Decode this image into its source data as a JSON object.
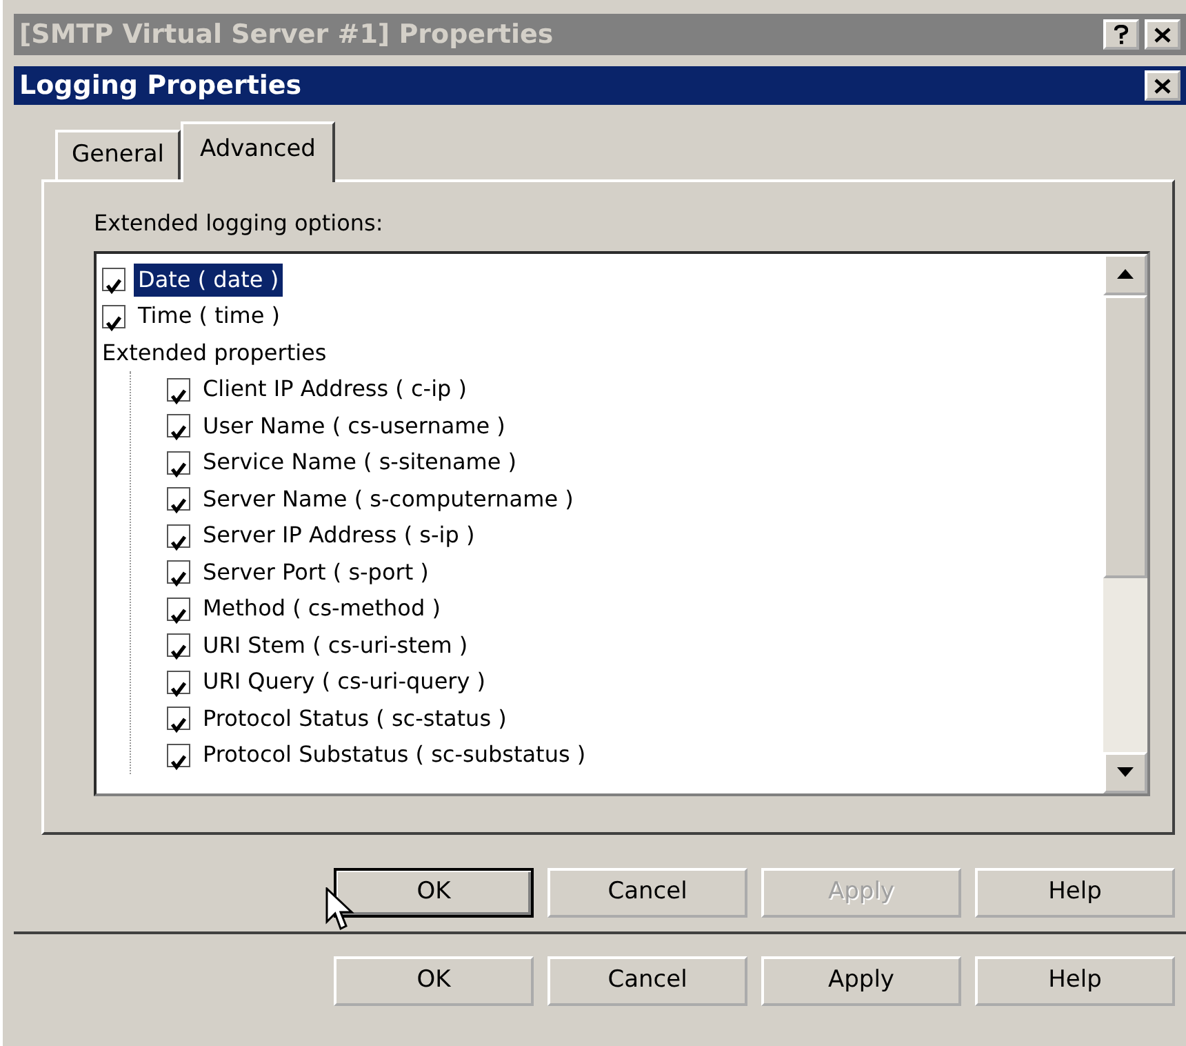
{
  "outer_window": {
    "title": "[SMTP Virtual Server #1] Properties",
    "buttons": [
      {
        "label": "OK",
        "disabled": false,
        "default": false
      },
      {
        "label": "Cancel",
        "disabled": false,
        "default": false
      },
      {
        "label": "Apply",
        "disabled": false,
        "default": false
      },
      {
        "label": "Help",
        "disabled": false,
        "default": false
      }
    ]
  },
  "dialog": {
    "title": "Logging Properties",
    "tabs": [
      {
        "label": "General",
        "selected": false
      },
      {
        "label": "Advanced",
        "selected": true
      }
    ],
    "group_label": "Extended logging options:",
    "options": [
      {
        "label": "Date ( date )",
        "checked": true,
        "selected": true
      },
      {
        "label": "Time ( time )",
        "checked": true,
        "selected": false
      },
      {
        "label": "Extended properties",
        "children": [
          {
            "label": "Client IP Address ( c-ip )",
            "checked": true,
            "selected": false
          },
          {
            "label": "User Name ( cs-username )",
            "checked": true,
            "selected": false
          },
          {
            "label": "Service Name ( s-sitename )",
            "checked": true,
            "selected": false
          },
          {
            "label": "Server Name ( s-computername )",
            "checked": true,
            "selected": false
          },
          {
            "label": "Server IP Address ( s-ip )",
            "checked": true,
            "selected": false
          },
          {
            "label": "Server Port ( s-port )",
            "checked": true,
            "selected": false
          },
          {
            "label": "Method ( cs-method )",
            "checked": true,
            "selected": false
          },
          {
            "label": "URI Stem ( cs-uri-stem )",
            "checked": true,
            "selected": false
          },
          {
            "label": "URI Query ( cs-uri-query )",
            "checked": true,
            "selected": false
          },
          {
            "label": "Protocol Status ( sc-status )",
            "checked": true,
            "selected": false
          },
          {
            "label": "Protocol Substatus ( sc-substatus )",
            "checked": true,
            "selected": false
          }
        ]
      }
    ],
    "buttons": [
      {
        "label": "OK",
        "disabled": false,
        "default": true
      },
      {
        "label": "Cancel",
        "disabled": false,
        "default": false
      },
      {
        "label": "Apply",
        "disabled": true,
        "default": false
      },
      {
        "label": "Help",
        "disabled": false,
        "default": false
      }
    ]
  }
}
